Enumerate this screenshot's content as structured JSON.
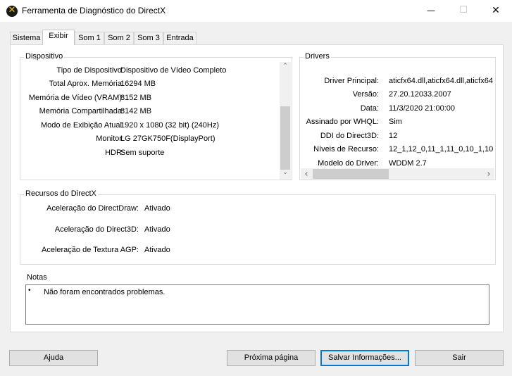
{
  "window": {
    "title": "Ferramenta de Diagnóstico do DirectX",
    "minimize": "—",
    "maximize": "☐",
    "close": "✕"
  },
  "tabs": [
    "Sistema",
    "Exibir",
    "Som 1",
    "Som 2",
    "Som 3",
    "Entrada"
  ],
  "active_tab": "Exibir",
  "device": {
    "title": "Dispositivo",
    "rows": [
      {
        "label": "Tipo de Dispositivo:",
        "value": "Dispositivo de Vídeo Completo"
      },
      {
        "label": "Total Aprox. Memória:",
        "value": "16294 MB"
      },
      {
        "label": "Memória de Vídeo (VRAM):",
        "value": "8152 MB"
      },
      {
        "label": "Memória Compartilhada:",
        "value": "8142 MB"
      },
      {
        "label": "Modo de Exibição Atual:",
        "value": "1920 x 1080 (32 bit) (240Hz)"
      },
      {
        "label": "Monitor:",
        "value": "LG 27GK750F(DisplayPort)"
      },
      {
        "label": "HDR:",
        "value": "Sem suporte"
      }
    ]
  },
  "drivers": {
    "title": "Drivers",
    "rows": [
      {
        "label": "Driver Principal:",
        "value": "aticfx64.dll,aticfx64.dll,aticfx64"
      },
      {
        "label": "Versão:",
        "value": "27.20.12033.2007"
      },
      {
        "label": "Data:",
        "value": "11/3/2020 21:00:00"
      },
      {
        "label": "Assinado por WHQL:",
        "value": "Sim"
      },
      {
        "label": "DDI do Direct3D:",
        "value": "12"
      },
      {
        "label": "Níveis de Recurso:",
        "value": "12_1,12_0,11_1,11_0,10_1,10"
      },
      {
        "label": "Modelo do Driver:",
        "value": "WDDM 2.7"
      }
    ]
  },
  "features": {
    "title": "Recursos do DirectX",
    "rows": [
      {
        "label": "Aceleração do DirectDraw:",
        "value": "Ativado"
      },
      {
        "label": "Aceleração do Direct3D:",
        "value": "Ativado"
      },
      {
        "label": "Aceleração de Textura AGP:",
        "value": "Ativado"
      }
    ]
  },
  "notes": {
    "title": "Notas",
    "bullet": "•",
    "items": [
      "Não foram encontrados problemas."
    ]
  },
  "buttons": {
    "help": "Ajuda",
    "next": "Próxima página",
    "save": "Salvar Informações...",
    "exit": "Sair"
  },
  "scroll_glyphs": {
    "up": "⌃",
    "down": "⌄",
    "left": "‹",
    "right": "›"
  }
}
